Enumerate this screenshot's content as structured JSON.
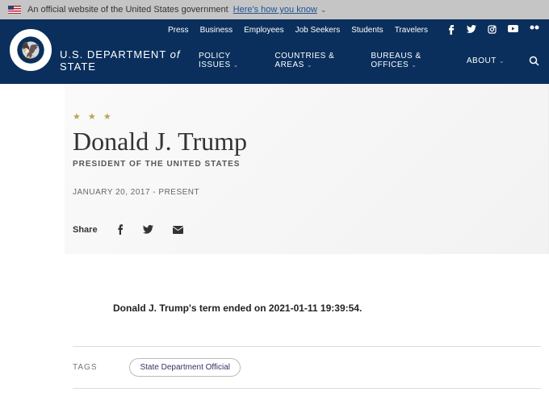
{
  "gov_banner": {
    "text": "An official website of the United States government",
    "link": "Here's how you know"
  },
  "top_nav": [
    "Press",
    "Business",
    "Employees",
    "Job Seekers",
    "Students",
    "Travelers"
  ],
  "dept_name_pre": "U.S. DEPARTMENT ",
  "dept_name_of": "of",
  "dept_name_post": " STATE",
  "main_nav": [
    "POLICY ISSUES",
    "COUNTRIES & AREAS",
    "BUREAUS & OFFICES",
    "ABOUT"
  ],
  "bio": {
    "name": "Donald J. Trump",
    "title": "PRESIDENT OF THE UNITED STATES",
    "term": "JANUARY 20, 2017 - PRESENT"
  },
  "share_label": "Share",
  "body_text": "Donald J. Trump's term ended on 2021-01-11 19:39:54.",
  "tags_label": "TAGS",
  "tags": [
    "State Department Official"
  ]
}
